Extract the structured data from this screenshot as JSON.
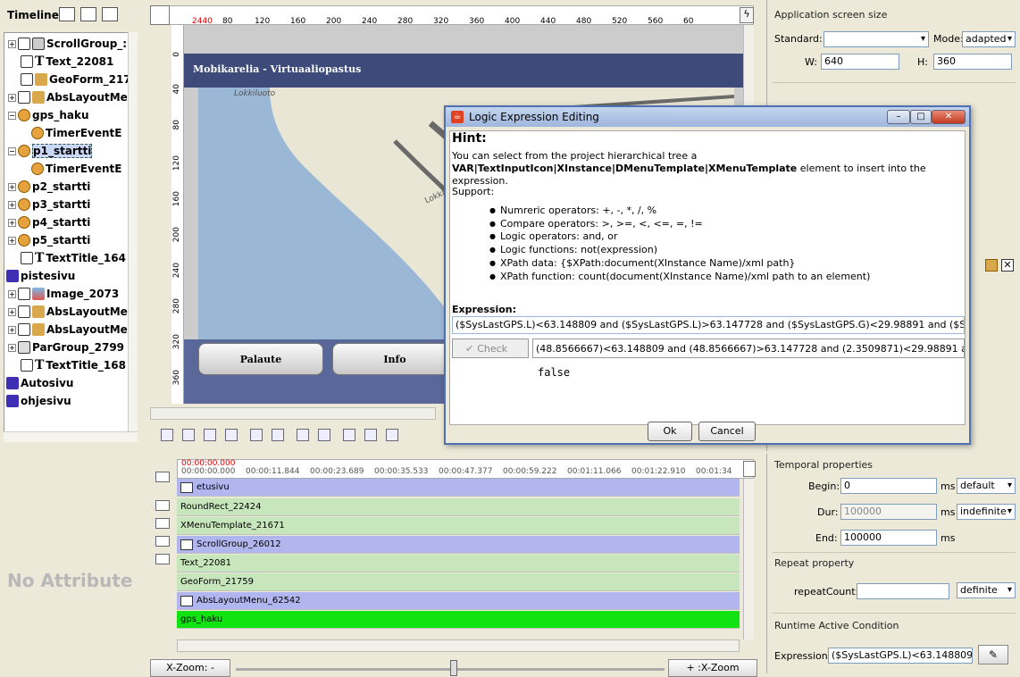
{
  "timeline_label": "Timeline:",
  "tree": {
    "items": [
      {
        "label": "ScrollGroup_:",
        "icon": "scrollgroup-icon"
      },
      {
        "label": "Text_22081",
        "icon": "text-icon"
      },
      {
        "label": "GeoForm_217",
        "icon": "geoform-icon"
      },
      {
        "label": "AbsLayoutMe",
        "icon": "abslayout-icon"
      },
      {
        "label": "gps_haku",
        "icon": "clock-icon"
      },
      {
        "label": "TimerEventE",
        "icon": "clock-icon"
      },
      {
        "label": "p1_startti",
        "icon": "clock-icon"
      },
      {
        "label": "TimerEventE",
        "icon": "clock-icon"
      },
      {
        "label": "p2_startti",
        "icon": "clock-icon"
      },
      {
        "label": "p3_startti",
        "icon": "clock-icon"
      },
      {
        "label": "p4_startti",
        "icon": "clock-icon"
      },
      {
        "label": "p5_startti",
        "icon": "clock-icon"
      },
      {
        "label": "TextTitle_164",
        "icon": "text-icon"
      },
      {
        "label": "pistesivu",
        "icon": "folder-icon"
      },
      {
        "label": "Image_2073",
        "icon": "image-icon"
      },
      {
        "label": "AbsLayoutMe",
        "icon": "abslayout-icon"
      },
      {
        "label": "AbsLayoutMe",
        "icon": "abslayout-icon"
      },
      {
        "label": "ParGroup_2799",
        "icon": "pargroup-icon"
      },
      {
        "label": "TextTitle_168",
        "icon": "text-icon"
      },
      {
        "label": "Autosivu",
        "icon": "folder-icon"
      },
      {
        "label": "ohjesivu",
        "icon": "folder-icon"
      }
    ]
  },
  "ruler_top": [
    "2440",
    "80",
    "120",
    "160",
    "200",
    "240",
    "280",
    "320",
    "360",
    "400",
    "440",
    "480",
    "520",
    "560",
    "60"
  ],
  "ruler_left": [
    "0",
    "40",
    "80",
    "120",
    "160",
    "200",
    "240",
    "280",
    "320",
    "360"
  ],
  "app": {
    "title": "Mobikarelia - Virtuaaliopastus",
    "map_label_top": "Lokkiluoto",
    "map_label_mid": "Lokkinieme",
    "btn_palaute": "Palaute",
    "btn_info": "Info"
  },
  "dialog": {
    "title": "Logic Expression Editing",
    "hint_title": "Hint:",
    "hint_line1": "You can select from the project hierarchical tree a",
    "hint_line2": "VAR|TextInputIcon|XInstance|DMenuTemplate|XMenuTemplate",
    "hint_line2b": " element to insert into the",
    "hint_line3": "expression.",
    "hint_line4": "Support:",
    "bullets": [
      "Numreric operators: +, -, *, /, %",
      "Compare operators: >, >=, <, <=, =, !=",
      "Logic operators: and, or",
      "Logic functions: not(expression)",
      "XPath data: {$XPath:document(XInstance Name)/xml path}",
      "XPath function: count(document(XInstance Name)/xml path to an element)"
    ],
    "expression_label": "Expression:",
    "expression_value": "($SysLastGPS.L)<63.148809 and ($SysLastGPS.L)>63.147728 and ($SysLastGPS.G)<29.98891 and ($SysLastG",
    "check_label": "Check",
    "evaluated_value": "(48.8566667)<63.148809 and (48.8566667)>63.147728 and (2.3509871)<29.98891 and (2.:",
    "result": "false",
    "ok": "Ok",
    "cancel": "Cancel"
  },
  "right": {
    "screen_size_title": "Application screen size",
    "standard_label": "Standard:",
    "standard_value": "",
    "mode_label": "Mode:",
    "mode_value": "adapted",
    "w_label": "W:",
    "w_value": "640",
    "h_label": "H:",
    "h_value": "360"
  },
  "no_attribute": "No Attribute",
  "timeline": {
    "ticks": [
      "00:00:00.000",
      "00:00:11.844",
      "00:00:23.689",
      "00:00:35.533",
      "00:00:47.377",
      "00:00:59.222",
      "00:01:11.066",
      "00:01:22.910",
      "00:01:34"
    ],
    "current_time": "00:00:00.000",
    "rows": [
      {
        "label": "etusivu",
        "style": "blue"
      },
      {
        "label": "RoundRect_22424",
        "style": "green"
      },
      {
        "label": "XMenuTemplate_21671",
        "style": "green"
      },
      {
        "label": "ScrollGroup_26012",
        "style": "blue"
      },
      {
        "label": "Text_22081",
        "style": "green"
      },
      {
        "label": "GeoForm_21759",
        "style": "green"
      },
      {
        "label": "AbsLayoutMenu_62542",
        "style": "blue"
      },
      {
        "label": "gps_haku",
        "style": "bright"
      }
    ],
    "xzoom_minus": "X-Zoom: -",
    "xzoom_plus": "+ :X-Zoom"
  },
  "temporal": {
    "title": "Temporal properties",
    "begin_label": "Begin:",
    "begin_value": "0",
    "begin_unit": "ms",
    "begin_mode": "default",
    "dur_label": "Dur:",
    "dur_value": "100000",
    "dur_unit": "ms",
    "dur_mode": "indefinite",
    "end_label": "End:",
    "end_value": "100000",
    "end_unit": "ms"
  },
  "repeat": {
    "title": "Repeat property",
    "count_label": "repeatCount:",
    "count_value": "",
    "mode": "definite"
  },
  "runtime": {
    "title": "Runtime Active Condition",
    "expression_label": "Expression:",
    "expression_value": "($SysLastGPS.L)<63.148809 ."
  }
}
